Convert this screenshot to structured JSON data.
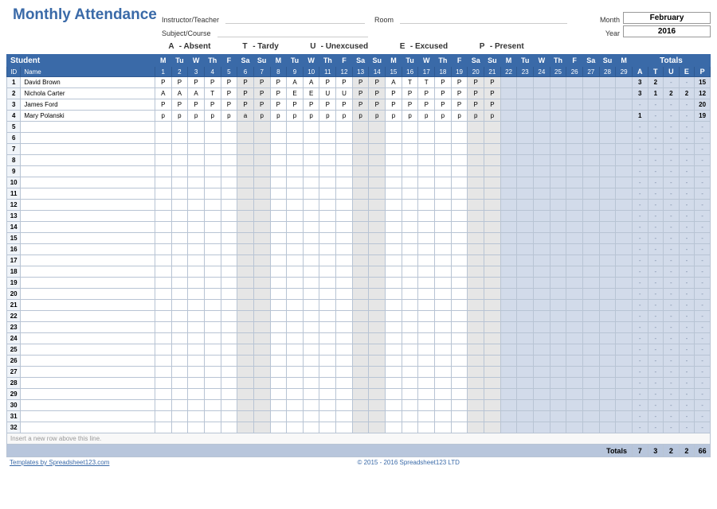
{
  "title": "Monthly Attendance",
  "labels": {
    "instructor": "Instructor/Teacher",
    "subject": "Subject/Course",
    "room": "Room",
    "month": "Month",
    "year": "Year",
    "student": "Student",
    "id": "ID",
    "name": "Name",
    "totals": "Totals",
    "insert_hint": "Insert a new row above this line.",
    "grand_totals": "Totals"
  },
  "period": {
    "month": "February",
    "year": "2016"
  },
  "legend": [
    {
      "code": "A",
      "desc": "- Absent"
    },
    {
      "code": "T",
      "desc": "- Tardy"
    },
    {
      "code": "U",
      "desc": "- Unexcused"
    },
    {
      "code": "E",
      "desc": "- Excused"
    },
    {
      "code": "P",
      "desc": "- Present"
    }
  ],
  "days": [
    {
      "n": 1,
      "w": "M"
    },
    {
      "n": 2,
      "w": "Tu"
    },
    {
      "n": 3,
      "w": "W"
    },
    {
      "n": 4,
      "w": "Th"
    },
    {
      "n": 5,
      "w": "F"
    },
    {
      "n": 6,
      "w": "Sa",
      "we": true
    },
    {
      "n": 7,
      "w": "Su",
      "we": true
    },
    {
      "n": 8,
      "w": "M"
    },
    {
      "n": 9,
      "w": "Tu"
    },
    {
      "n": 10,
      "w": "W"
    },
    {
      "n": 11,
      "w": "Th"
    },
    {
      "n": 12,
      "w": "F"
    },
    {
      "n": 13,
      "w": "Sa",
      "we": true
    },
    {
      "n": 14,
      "w": "Su",
      "we": true
    },
    {
      "n": 15,
      "w": "M"
    },
    {
      "n": 16,
      "w": "Tu"
    },
    {
      "n": 17,
      "w": "W"
    },
    {
      "n": 18,
      "w": "Th"
    },
    {
      "n": 19,
      "w": "F"
    },
    {
      "n": 20,
      "w": "Sa",
      "we": true
    },
    {
      "n": 21,
      "w": "Su",
      "we": true
    },
    {
      "n": 22,
      "w": "M"
    },
    {
      "n": 23,
      "w": "Tu"
    },
    {
      "n": 24,
      "w": "W"
    },
    {
      "n": 25,
      "w": "Th"
    },
    {
      "n": 26,
      "w": "F"
    },
    {
      "n": 27,
      "w": "Sa",
      "we": true
    },
    {
      "n": 28,
      "w": "Su",
      "we": true
    },
    {
      "n": 29,
      "w": "M"
    }
  ],
  "tot_codes": [
    "A",
    "T",
    "U",
    "E",
    "P"
  ],
  "students": [
    {
      "id": "1",
      "name": "David Brown",
      "marks": [
        "P",
        "P",
        "P",
        "P",
        "P",
        "P",
        "P",
        "P",
        "A",
        "A",
        "P",
        "P",
        "P",
        "P",
        "A",
        "T",
        "T",
        "P",
        "P",
        "P",
        "P",
        "",
        "",
        "",
        "",
        "",
        "",
        "",
        ""
      ],
      "totals": {
        "A": "3",
        "T": "2",
        "U": "-",
        "E": "-",
        "P": "15"
      }
    },
    {
      "id": "2",
      "name": "Nichola Carter",
      "marks": [
        "A",
        "A",
        "A",
        "T",
        "P",
        "P",
        "P",
        "P",
        "E",
        "E",
        "U",
        "U",
        "P",
        "P",
        "P",
        "P",
        "P",
        "P",
        "P",
        "P",
        "P",
        "",
        "",
        "",
        "",
        "",
        "",
        "",
        ""
      ],
      "totals": {
        "A": "3",
        "T": "1",
        "U": "2",
        "E": "2",
        "P": "12"
      }
    },
    {
      "id": "3",
      "name": "James Ford",
      "marks": [
        "P",
        "P",
        "P",
        "P",
        "P",
        "P",
        "P",
        "P",
        "P",
        "P",
        "P",
        "P",
        "P",
        "P",
        "P",
        "P",
        "P",
        "P",
        "P",
        "P",
        "P",
        "",
        "",
        "",
        "",
        "",
        "",
        "",
        ""
      ],
      "totals": {
        "A": "-",
        "T": "-",
        "U": "-",
        "E": "-",
        "P": "20"
      }
    },
    {
      "id": "4",
      "name": "Mary Polanski",
      "marks": [
        "p",
        "p",
        "p",
        "p",
        "p",
        "a",
        "p",
        "p",
        "p",
        "p",
        "p",
        "p",
        "p",
        "p",
        "p",
        "p",
        "p",
        "p",
        "p",
        "p",
        "p",
        "",
        "",
        "",
        "",
        "",
        "",
        "",
        ""
      ],
      "totals": {
        "A": "1",
        "T": "-",
        "U": "-",
        "E": "-",
        "P": "19"
      }
    }
  ],
  "empty_rows": [
    "5",
    "6",
    "7",
    "8",
    "9",
    "10",
    "11",
    "12",
    "13",
    "14",
    "15",
    "16",
    "17",
    "18",
    "19",
    "20",
    "21",
    "22",
    "23",
    "24",
    "25",
    "26",
    "27",
    "28",
    "29",
    "30",
    "31",
    "32"
  ],
  "grand_totals": {
    "A": "7",
    "T": "3",
    "U": "2",
    "E": "2",
    "P": "66"
  },
  "footer": {
    "template_link": "Templates by Spreadsheet123.com",
    "copyright": "© 2015 - 2016 Spreadsheet123 LTD"
  }
}
